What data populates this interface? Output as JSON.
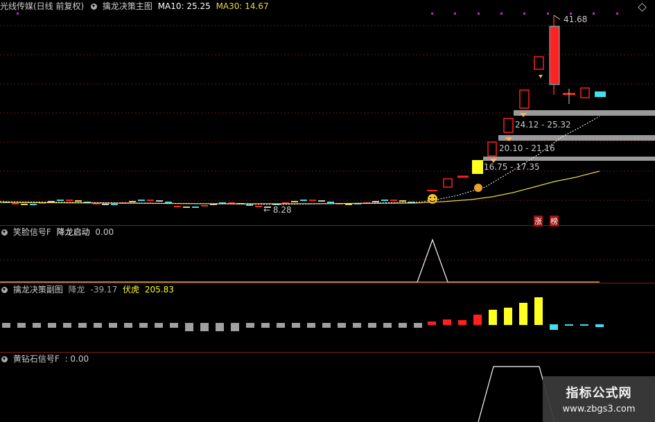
{
  "main": {
    "title": "光线传媒(日线 前复权)",
    "indicator": "擒龙决策主图",
    "ma10_label": "MA10: 25.25",
    "ma30_label": "MA30: 14.67",
    "high_label": "41.68",
    "low_label": "← 8.28",
    "zones": [
      "24.12 - 25.32",
      "20.10 - 21.16",
      "16.75 - 17.35"
    ],
    "tags": [
      "涨",
      "榜"
    ]
  },
  "panel2": {
    "title": "笑脸信号F",
    "label": "降龙启动",
    "value": "0.00"
  },
  "panel3": {
    "title": "擒龙决策副图",
    "label1": "降龙",
    "value1": "-39.17",
    "label2": "伏虎",
    "value2": "205.83"
  },
  "panel4": {
    "title": "黄钻石信号F",
    "value": ": 0.00"
  },
  "watermark": {
    "title": "指标公式网",
    "url": "www.zbgs3.com"
  },
  "colors": {
    "up": "#ff2020",
    "down": "#40e0f0",
    "ma10": "#ffffff",
    "ma30": "#e8d84a",
    "yellow": "#ffff20",
    "grid": "#8a1a1a"
  },
  "chart_data": {
    "type": "candlestick",
    "visible_prices": {
      "high": 41.68,
      "low": 8.28
    },
    "zones": [
      [
        24.12,
        25.32
      ],
      [
        20.1,
        21.16
      ],
      [
        16.75,
        17.35
      ]
    ],
    "sub_histogram": {
      "降龙": -39.17,
      "伏虎": 205.83
    }
  }
}
